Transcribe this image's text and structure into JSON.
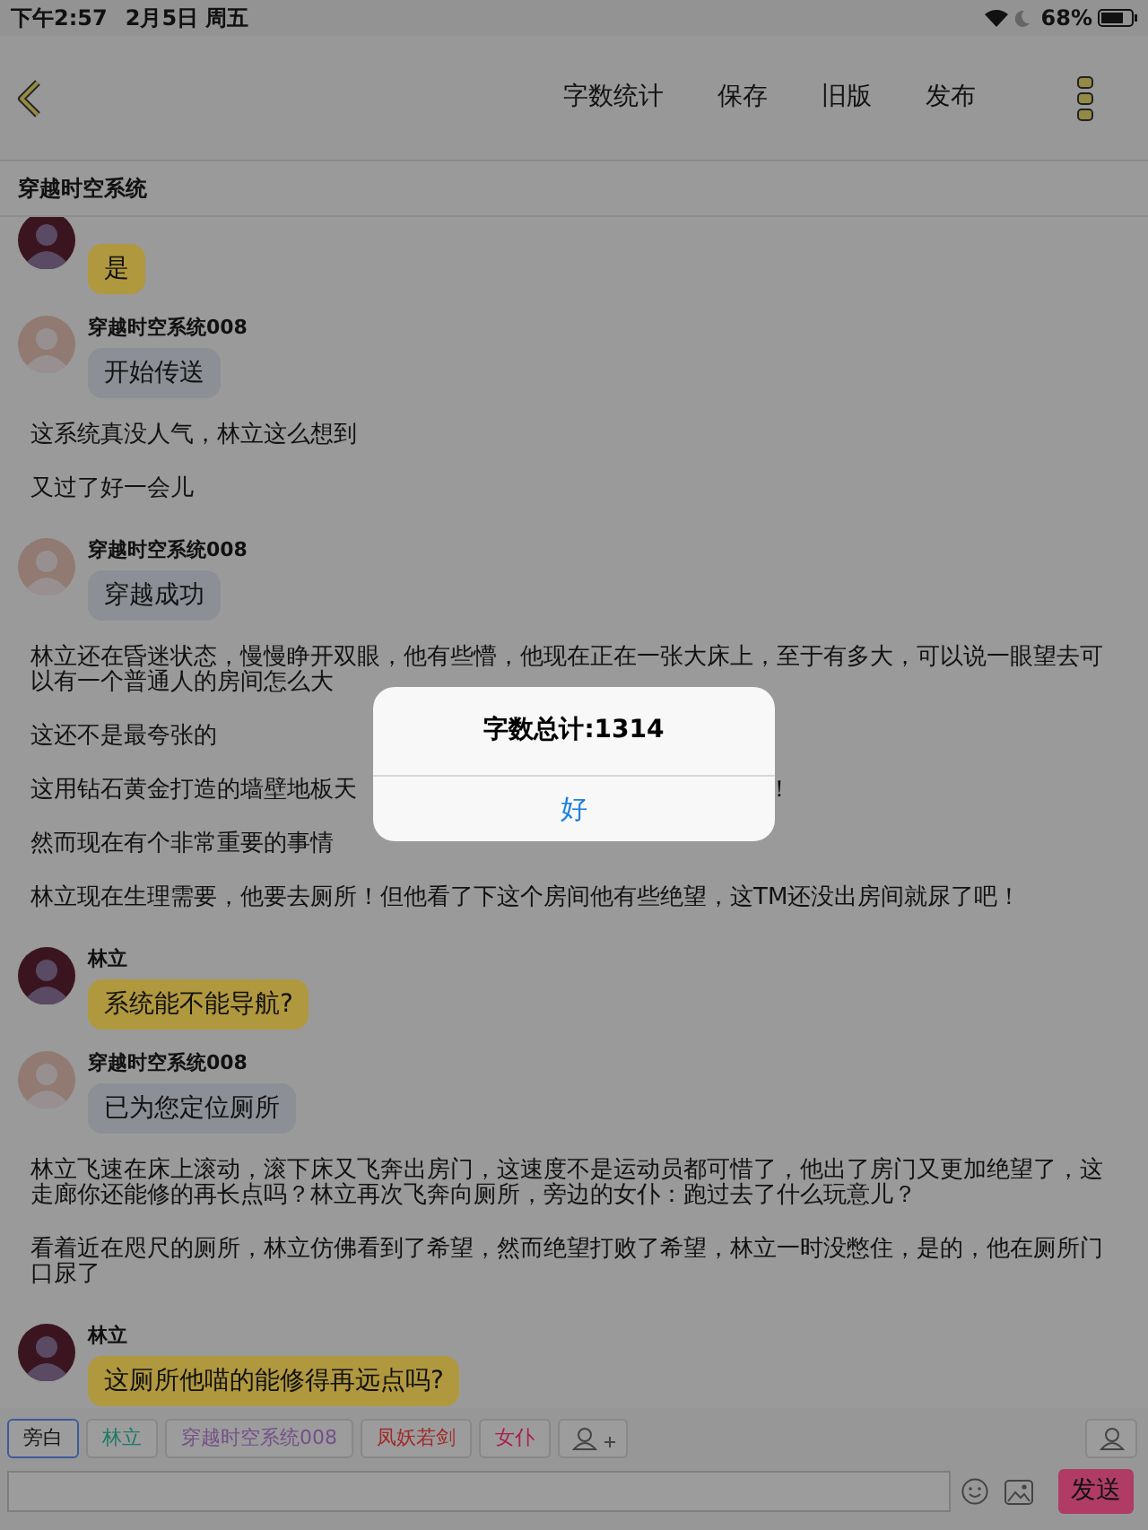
{
  "status_bar": {
    "time": "下午2:57",
    "date": "2月5日 周五",
    "battery": "68%"
  },
  "nav": {
    "actions": [
      "字数统计",
      "保存",
      "旧版",
      "发布"
    ]
  },
  "chapter_title": "穿越时空系统",
  "messages": [
    {
      "kind": "bubble",
      "color": "#b0983e",
      "text": "是"
    },
    {
      "kind": "bubble",
      "speaker": "穿越时空系统008",
      "color": "#8c8f95",
      "text": "开始传送"
    },
    {
      "kind": "narration",
      "text": "这系统真没人气，林立这么想到"
    },
    {
      "kind": "narration",
      "text": "又过了好一会儿"
    },
    {
      "kind": "bubble",
      "speaker": "穿越时空系统008",
      "color": "#8c8f95",
      "text": "穿越成功"
    },
    {
      "kind": "narration",
      "text": "林立还在昏迷状态，慢慢睁开双眼，他有些懵，他现在正在一张大床上，至于有多大，可以说一眼望去可以有一个普通人的房间怎么大"
    },
    {
      "kind": "narration",
      "text": "这还不是最夸张的"
    },
    {
      "kind": "split",
      "start": "这用钻石黄金打造的墙壁地板天",
      "end": "！"
    },
    {
      "kind": "narration",
      "text": "然而现在有个非常重要的事情"
    },
    {
      "kind": "narration",
      "text": "林立现在生理需要，他要去厕所！但他看了下这个房间他有些绝望，这TM还没出房间就尿了吧！"
    },
    {
      "kind": "bubble",
      "speaker": "林立",
      "color": "#b0983e",
      "text": "系统能不能导航?"
    },
    {
      "kind": "bubble",
      "speaker": "穿越时空系统008",
      "color": "#8c8f95",
      "text": "已为您定位厕所"
    },
    {
      "kind": "narration",
      "text": "林立飞速在床上滚动，滚下床又飞奔出房门，这速度不是运动员都可惜了，他出了房门又更加绝望了，这走廊你还能修的再长点吗？林立再次飞奔向厕所，旁边的女仆：跑过去了什么玩意儿？"
    },
    {
      "kind": "narration",
      "text": "看着近在咫尺的厕所，林立仿佛看到了希望，然而绝望打败了希望，林立一时没憋住，是的，他在厕所门口尿了"
    },
    {
      "kind": "bubble",
      "speaker": "林立",
      "color": "#b0983e",
      "text": "这厕所他喵的能修得再远点吗?"
    }
  ],
  "characters": [
    {
      "name": "旁白",
      "selected": true,
      "color": "#151515"
    },
    {
      "name": "林立",
      "selected": false,
      "color": "#1f7a66"
    },
    {
      "name": "穿越时空系统008",
      "selected": false,
      "color": "#74508a"
    },
    {
      "name": "凤妖若剑",
      "selected": false,
      "color": "#a02a2a"
    },
    {
      "name": "女仆",
      "selected": false,
      "color": "#a82050"
    }
  ],
  "send_button": "发送",
  "alert": {
    "title": "字数总计:1314",
    "button": "好"
  }
}
